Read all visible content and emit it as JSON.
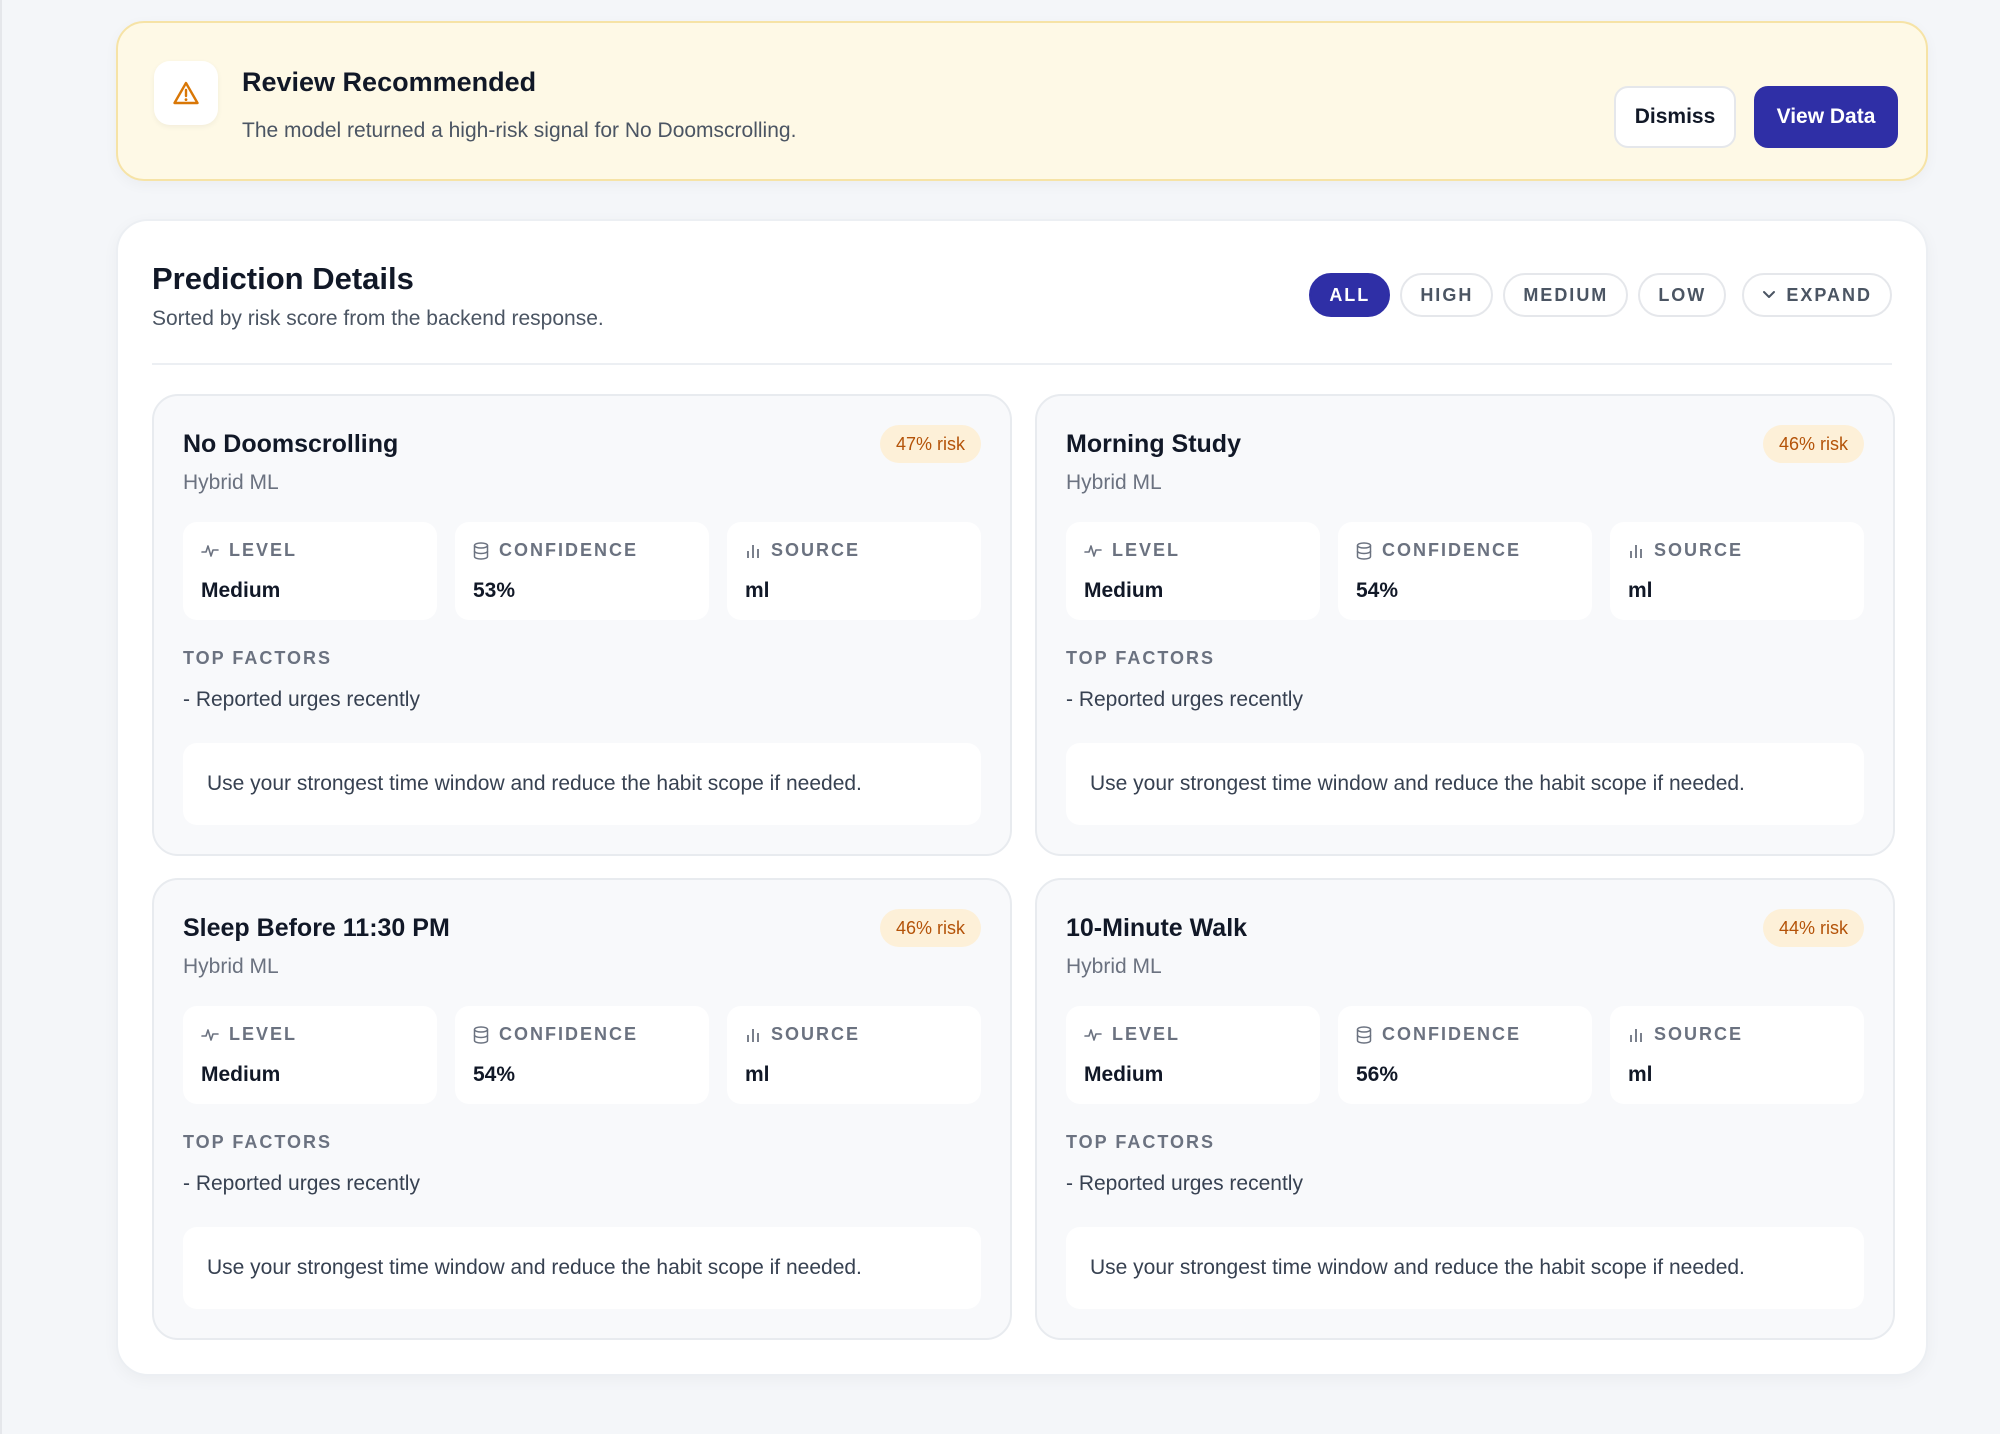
{
  "alert": {
    "icon": "warning-triangle-icon",
    "title": "Review Recommended",
    "message": "The model returned a high-risk signal for No Doomscrolling.",
    "dismiss_label": "Dismiss",
    "view_label": "View Data",
    "colors": {
      "background": "#fef9e6",
      "border": "#f6e3a6",
      "icon": "#d97706"
    }
  },
  "panel": {
    "title": "Prediction Details",
    "subtitle": "Sorted by risk score from the backend response.",
    "filters": [
      {
        "label": "ALL",
        "active": true
      },
      {
        "label": "HIGH",
        "active": false
      },
      {
        "label": "MEDIUM",
        "active": false
      },
      {
        "label": "LOW",
        "active": false
      }
    ],
    "expand_label": "EXPAND",
    "accent_color": "#2f2fa6"
  },
  "predictions": [
    {
      "title": "No Doomscrolling",
      "model": "Hybrid ML",
      "risk_badge": "47% risk",
      "risk": 47,
      "level_label": "LEVEL",
      "level": "Medium",
      "confidence_label": "CONFIDENCE",
      "confidence": "53%",
      "source_label": "SOURCE",
      "source": "ml",
      "factors_title": "TOP FACTORS",
      "factor": "- Reported urges recently",
      "advice": "Use your strongest time window and reduce the habit scope if needed."
    },
    {
      "title": "Morning Study",
      "model": "Hybrid ML",
      "risk_badge": "46% risk",
      "risk": 46,
      "level_label": "LEVEL",
      "level": "Medium",
      "confidence_label": "CONFIDENCE",
      "confidence": "54%",
      "source_label": "SOURCE",
      "source": "ml",
      "factors_title": "TOP FACTORS",
      "factor": "- Reported urges recently",
      "advice": "Use your strongest time window and reduce the habit scope if needed."
    },
    {
      "title": "Sleep Before 11:30 PM",
      "model": "Hybrid ML",
      "risk_badge": "46% risk",
      "risk": 46,
      "level_label": "LEVEL",
      "level": "Medium",
      "confidence_label": "CONFIDENCE",
      "confidence": "54%",
      "source_label": "SOURCE",
      "source": "ml",
      "factors_title": "TOP FACTORS",
      "factor": "- Reported urges recently",
      "advice": "Use your strongest time window and reduce the habit scope if needed."
    },
    {
      "title": "10-Minute Walk",
      "model": "Hybrid ML",
      "risk_badge": "44% risk",
      "risk": 44,
      "level_label": "LEVEL",
      "level": "Medium",
      "confidence_label": "CONFIDENCE",
      "confidence": "56%",
      "source_label": "SOURCE",
      "source": "ml",
      "factors_title": "TOP FACTORS",
      "factor": "- Reported urges recently",
      "advice": "Use your strongest time window and reduce the habit scope if needed."
    }
  ],
  "icons": {
    "level": "activity-pulse-icon",
    "confidence": "database-icon",
    "source": "bar-chart-icon",
    "expand": "chevron-down-icon"
  }
}
